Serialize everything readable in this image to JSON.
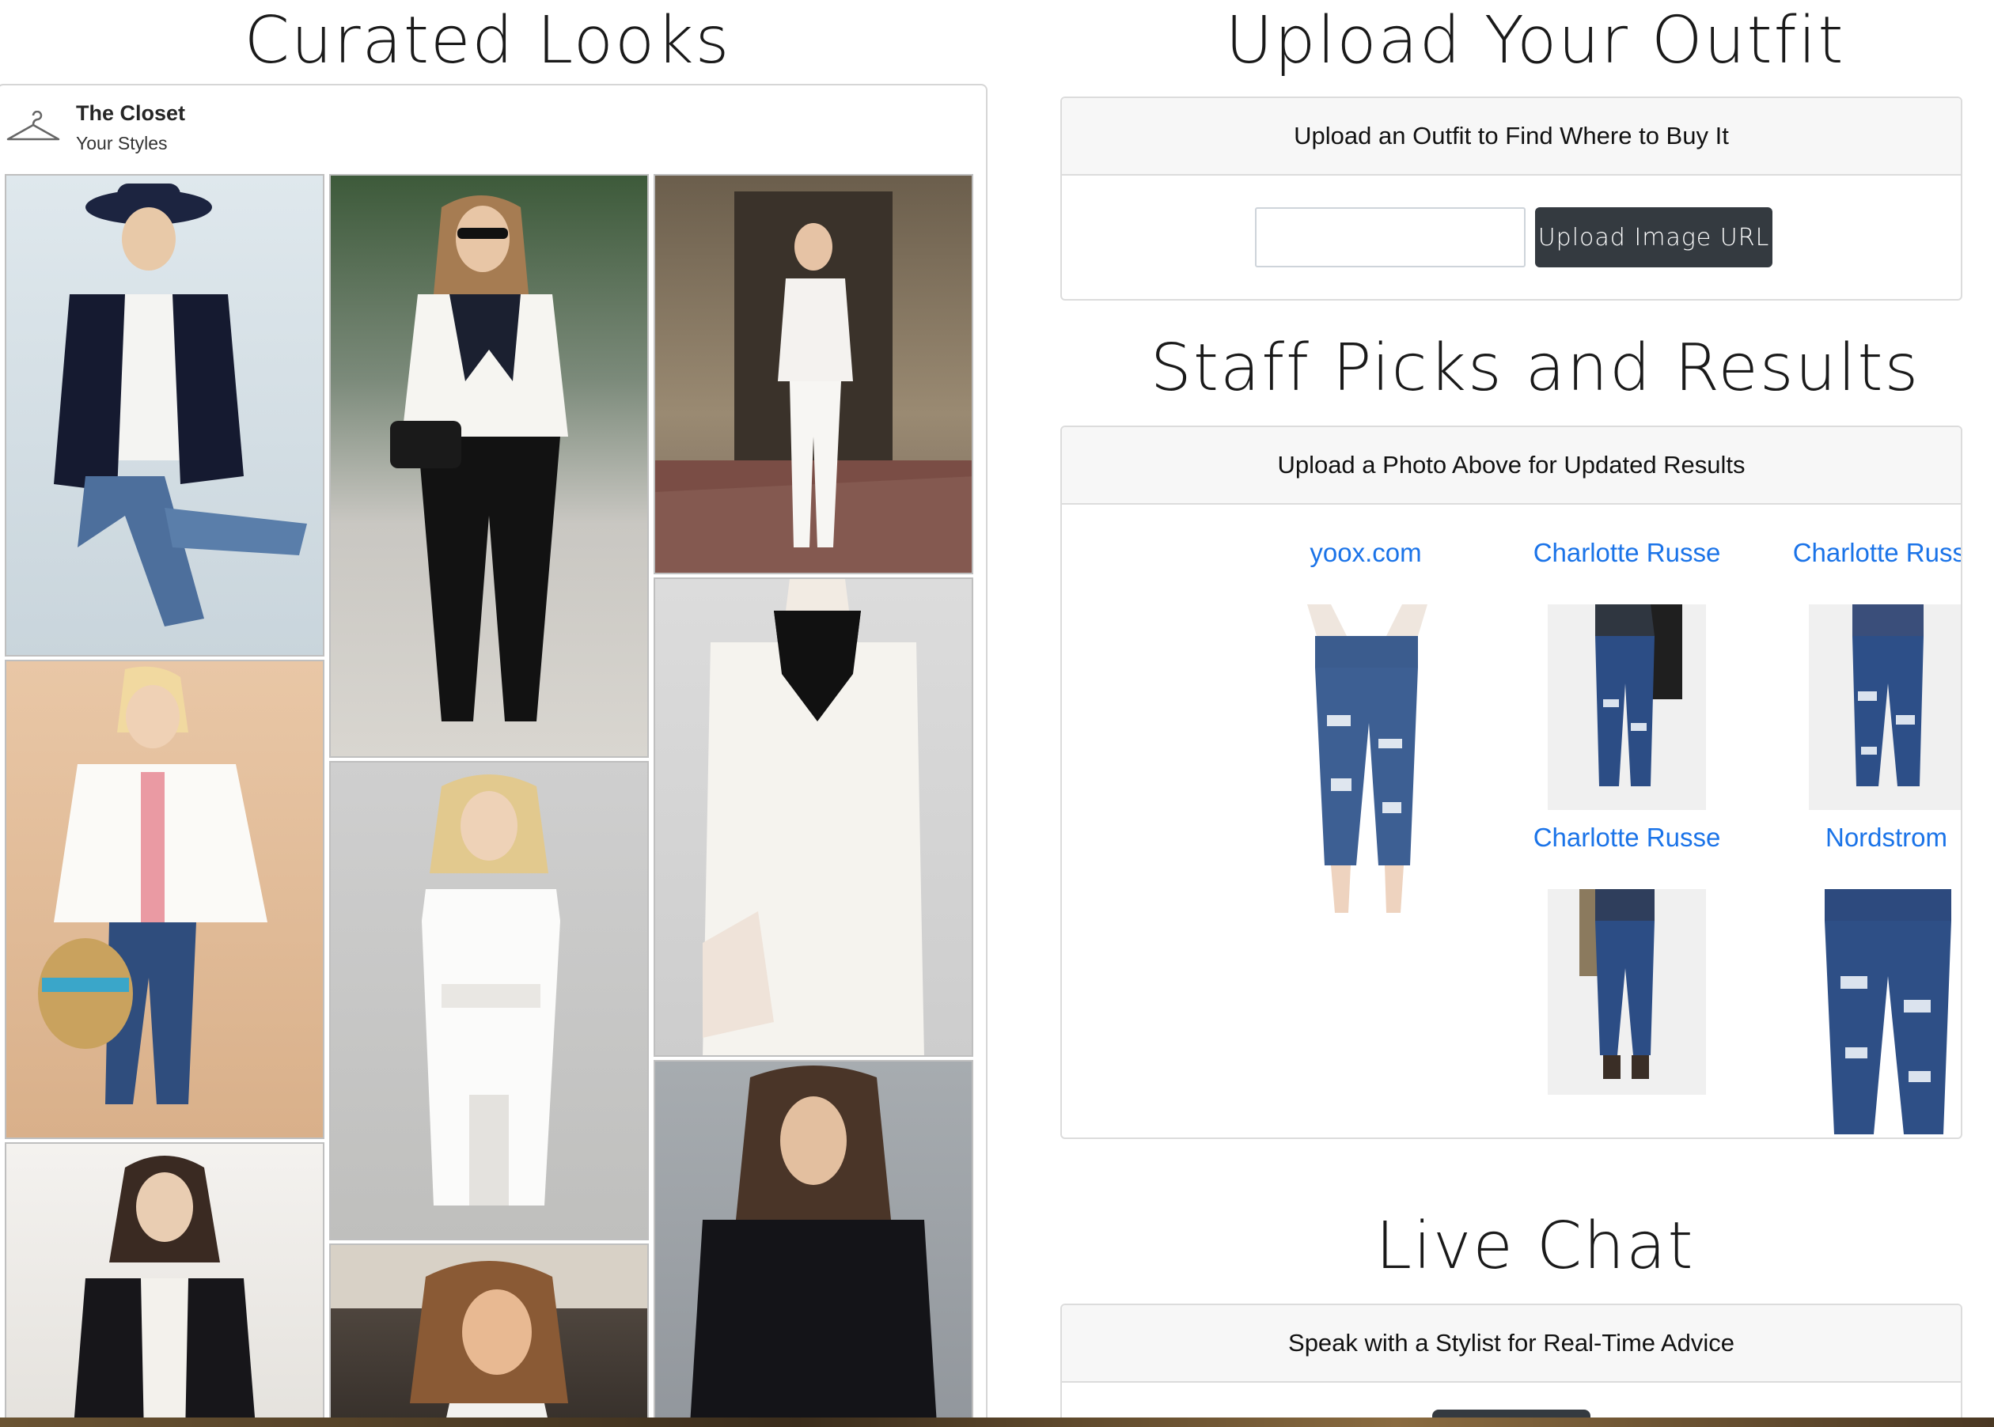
{
  "left": {
    "title": "Curated Looks",
    "closet": {
      "name": "The Closet",
      "subtitle": "Your Styles",
      "icon": "hanger-icon"
    },
    "photos": [
      {
        "name": "look-hat-blazer-jeans"
      },
      {
        "name": "look-scarf-black-trousers"
      },
      {
        "name": "look-white-suit-courtyard"
      },
      {
        "name": "look-embroidered-top-jeans"
      },
      {
        "name": "look-white-dress-black-scarf"
      },
      {
        "name": "look-white-lace-dress"
      },
      {
        "name": "look-black-cardigan"
      },
      {
        "name": "look-white-top-street"
      },
      {
        "name": "look-black-sweater"
      }
    ]
  },
  "upload": {
    "title": "Upload Your Outfit",
    "card_header": "Upload an Outfit to Find Where to Buy It",
    "input_value": "",
    "button_label": "Upload Image URL"
  },
  "results": {
    "title": "Staff Picks and Results",
    "card_header": "Upload a Photo Above for Updated Results",
    "items": [
      {
        "store": "yoox.com"
      },
      {
        "store": "Charlotte Russe"
      },
      {
        "store": "Charlotte Russe"
      },
      {
        "store": "Charlotte Russe"
      },
      {
        "store": "Nordstrom"
      }
    ]
  },
  "chat": {
    "title": "Live Chat",
    "card_header": "Speak with a Stylist for Real-Time Advice"
  },
  "colors": {
    "link": "#1a73e8",
    "button_dark": "#343a40",
    "card_header_bg": "#f7f7f7"
  }
}
